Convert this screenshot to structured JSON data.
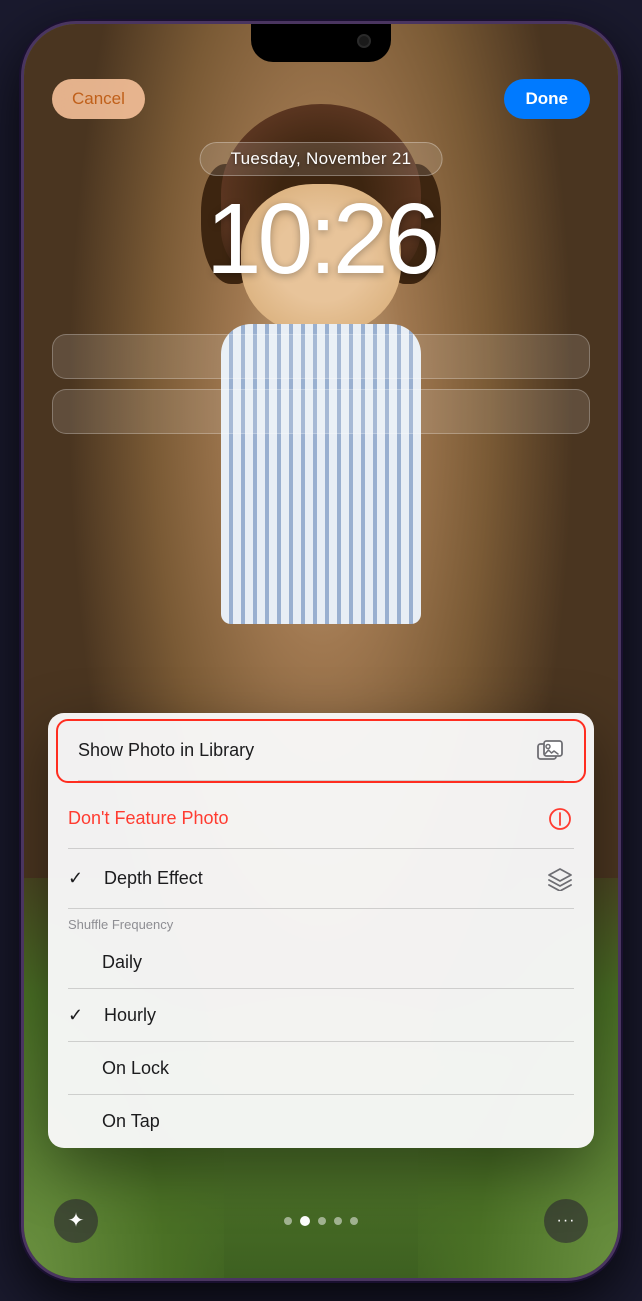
{
  "phone": {
    "buttons": {
      "cancel_label": "Cancel",
      "done_label": "Done"
    },
    "date": "Tuesday, November 21",
    "time": "10:26",
    "context_menu": {
      "item1": {
        "label": "Show Photo in Library",
        "icon": "photo-library-icon"
      },
      "item2": {
        "label": "Don't Feature Photo",
        "icon": "no-feature-icon"
      },
      "item3": {
        "checkmark": "✓",
        "label": "Depth Effect",
        "icon": "layers-icon"
      },
      "shuffle_header": "Shuffle Frequency",
      "item4": {
        "label": "Daily"
      },
      "item5": {
        "checkmark": "✓",
        "label": "Hourly"
      },
      "item6": {
        "label": "On Lock"
      },
      "item7": {
        "label": "On Tap"
      }
    },
    "toolbar": {
      "sparkle_label": "✦",
      "more_label": "···"
    }
  }
}
